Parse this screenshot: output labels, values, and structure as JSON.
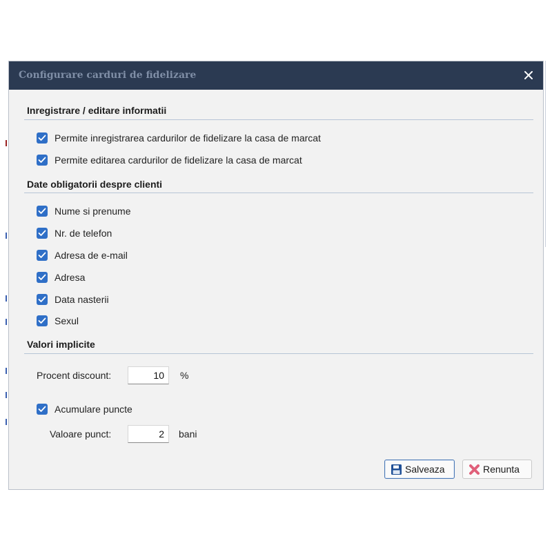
{
  "window": {
    "title": "Configurare carduri de fidelizare",
    "close_icon": "close-icon"
  },
  "sections": {
    "registration": {
      "title": "Inregistrare / editare informatii",
      "items": [
        {
          "label": "Permite inregistrarea cardurilor de fidelizare la casa de marcat",
          "checked": true
        },
        {
          "label": "Permite editarea cardurilor de fidelizare la casa de marcat",
          "checked": true
        }
      ]
    },
    "required": {
      "title": "Date obligatorii despre clienti",
      "items": [
        {
          "label": "Nume si prenume",
          "checked": true
        },
        {
          "label": "Nr. de telefon",
          "checked": true
        },
        {
          "label": "Adresa de e-mail",
          "checked": true
        },
        {
          "label": "Adresa",
          "checked": true
        },
        {
          "label": "Data nasterii",
          "checked": true
        },
        {
          "label": "Sexul",
          "checked": true
        }
      ]
    },
    "defaults": {
      "title": "Valori implicite",
      "discount_label": "Procent discount:",
      "discount_value": "10",
      "discount_unit": "%",
      "accumulate_label": "Acumulare puncte",
      "accumulate_checked": true,
      "point_value_label": "Valoare punct:",
      "point_value": "2",
      "point_value_unit": "bani"
    }
  },
  "buttons": {
    "save_label": "Salveaza",
    "save_icon": "save-icon",
    "cancel_label": "Renunta",
    "cancel_icon": "cancel-x-icon"
  },
  "colors": {
    "titlebar": "#2b3a52",
    "checkbox": "#2f6fc7",
    "dialog_bg": "#f2f2f2",
    "cancel_icon": "#e0607a"
  }
}
